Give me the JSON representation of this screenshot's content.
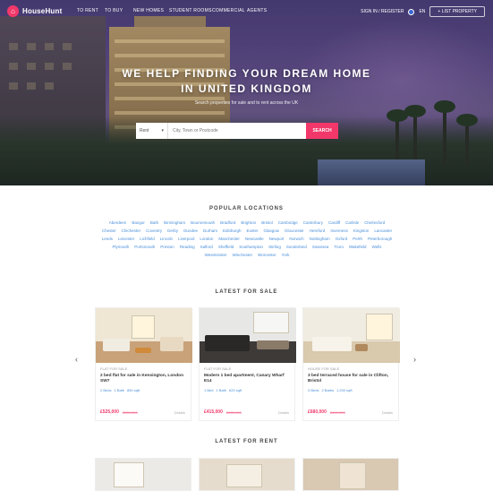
{
  "brand": {
    "name": "HouseHunt"
  },
  "nav": {
    "links": [
      "To Rent",
      "To Buy",
      "New Homes",
      "Student Rooms",
      "Commercial",
      "Agents"
    ],
    "login": "Sign In / Register",
    "lang": "EN",
    "cta": "+ List Property"
  },
  "hero": {
    "title_line1": "We Help Finding Your Dream Home",
    "title_line2": "In United Kingdom",
    "subtitle": "Search properties for sale and to rent across the UK",
    "search": {
      "type": "Rent",
      "placeholder": "City, Town or Postcode",
      "button": "Search"
    }
  },
  "popular": {
    "title": "Popular Locations",
    "items": [
      "Aberdeen",
      "Bangor",
      "Bath",
      "Birmingham",
      "Bournemouth",
      "Bradford",
      "Brighton",
      "Bristol",
      "Cambridge",
      "Canterbury",
      "Cardiff",
      "Carlisle",
      "Chelmsford",
      "Chester",
      "Chichester",
      "Coventry",
      "Derby",
      "Dundee",
      "Durham",
      "Edinburgh",
      "Exeter",
      "Glasgow",
      "Gloucester",
      "Hereford",
      "Inverness",
      "Kingston",
      "Lancaster",
      "Leeds",
      "Leicester",
      "Lichfield",
      "Lincoln",
      "Liverpool",
      "London",
      "Manchester",
      "Newcastle",
      "Newport",
      "Norwich",
      "Nottingham",
      "Oxford",
      "Perth",
      "Peterborough",
      "Plymouth",
      "Portsmouth",
      "Preston",
      "Reading",
      "Salford",
      "Sheffield",
      "Southampton",
      "Stirling",
      "Sunderland",
      "Swansea",
      "Truro",
      "Wakefield",
      "Wells",
      "Westminster",
      "Winchester",
      "Worcester",
      "York"
    ]
  },
  "sale": {
    "title": "Latest For Sale",
    "cards": [
      {
        "tag": "Flat for sale",
        "title": "2 bed flat for sale in Kensington, London SW7",
        "feats": [
          "2 Beds",
          "1 Bath",
          "850 sqft"
        ],
        "price": "£525,000",
        "old": "£550,000",
        "more": "Details"
      },
      {
        "tag": "Flat for sale",
        "title": "Modern 1 bed apartment, Canary Wharf E14",
        "feats": [
          "1 Bed",
          "1 Bath",
          "620 sqft"
        ],
        "price": "£415,000",
        "old": "£430,000",
        "more": "Details"
      },
      {
        "tag": "House for sale",
        "title": "3 bed terraced house for sale in Clifton, Bristol",
        "feats": [
          "3 Beds",
          "2 Baths",
          "1,200 sqft"
        ],
        "price": "£680,000",
        "old": "£699,000",
        "more": "Details"
      }
    ]
  },
  "rent": {
    "title": "Latest For Rent"
  },
  "colors": {
    "accent": "#f2386a",
    "link": "#4a8fd9"
  },
  "icons": {
    "left_arrow": "chevron-left-icon",
    "right_arrow": "chevron-right-icon"
  }
}
